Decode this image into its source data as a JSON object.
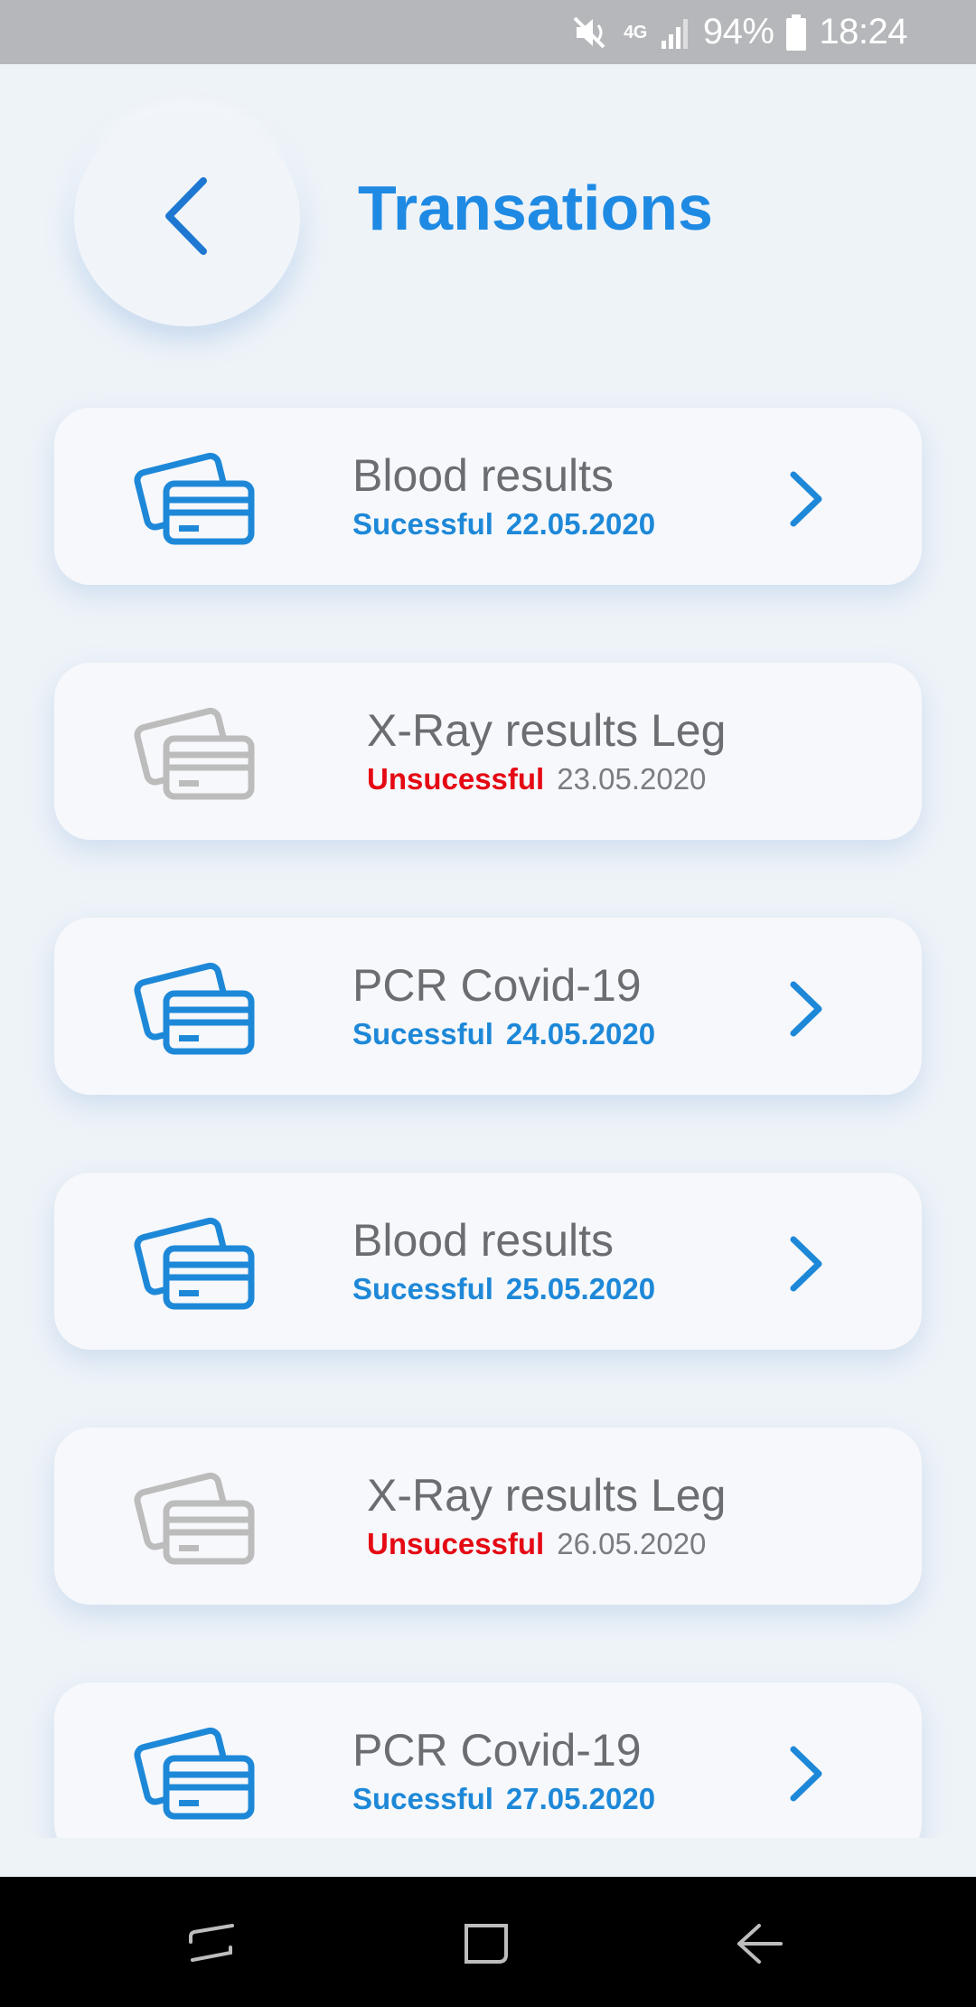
{
  "status_bar": {
    "battery": "94%",
    "time": "18:24",
    "network": "4G",
    "icons": [
      "mute-icon",
      "network-4g-icon",
      "signal-icon",
      "battery-icon"
    ]
  },
  "header": {
    "title": "Transations",
    "back_icon": "chevron-left-icon"
  },
  "colors": {
    "accent": "#1e8ae3",
    "success": "#1e88d8",
    "failure": "#e50914",
    "muted_icon": "#bcbcbc",
    "background": "#eef3f8",
    "card": "#f6f8fb"
  },
  "transactions": [
    {
      "title": "Blood results",
      "status": "Sucessful",
      "date": "22.05.2020",
      "successful": true
    },
    {
      "title": "X-Ray results Leg",
      "status": "Unsucessful",
      "date": "23.05.2020",
      "successful": false
    },
    {
      "title": "PCR Covid-19",
      "status": "Sucessful",
      "date": "24.05.2020",
      "successful": true
    },
    {
      "title": "Blood results",
      "status": "Sucessful",
      "date": "25.05.2020",
      "successful": true
    },
    {
      "title": "X-Ray results Leg",
      "status": "Unsucessful",
      "date": "26.05.2020",
      "successful": false
    },
    {
      "title": "PCR Covid-19",
      "status": "Sucessful",
      "date": "27.05.2020",
      "successful": true
    }
  ],
  "nav_bar": {
    "buttons": [
      "recent-apps-icon",
      "home-icon",
      "back-icon"
    ]
  }
}
